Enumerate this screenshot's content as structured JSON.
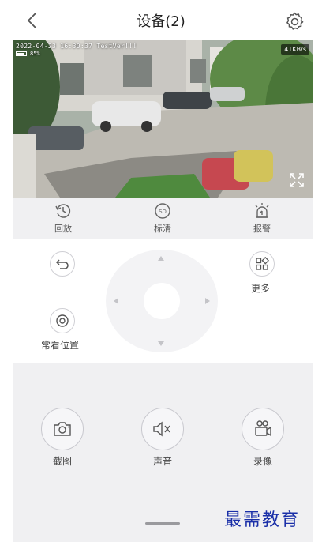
{
  "header": {
    "title": "设备(2)"
  },
  "video": {
    "timestamp_text": "2022-04-23 16:30:37 TestVer!!!",
    "battery_text": "85%",
    "speed": "41KB/s"
  },
  "toolbar": {
    "items": [
      {
        "label": "回放",
        "icon": "playback-clock-icon"
      },
      {
        "label": "标清",
        "icon": "sd-quality-icon"
      },
      {
        "label": "报警",
        "icon": "alarm-icon"
      }
    ]
  },
  "ptz": {
    "undo_icon": "undo-icon",
    "more_label": "更多",
    "preset_label": "常看位置"
  },
  "actions": {
    "items": [
      {
        "label": "截图",
        "icon": "camera-icon"
      },
      {
        "label": "声音",
        "icon": "speaker-mute-icon"
      },
      {
        "label": "录像",
        "icon": "record-video-icon"
      }
    ]
  },
  "watermark": "最需教育",
  "colors": {
    "panel_bg": "#f0f0f2",
    "watermark": "#1a2fa8"
  }
}
